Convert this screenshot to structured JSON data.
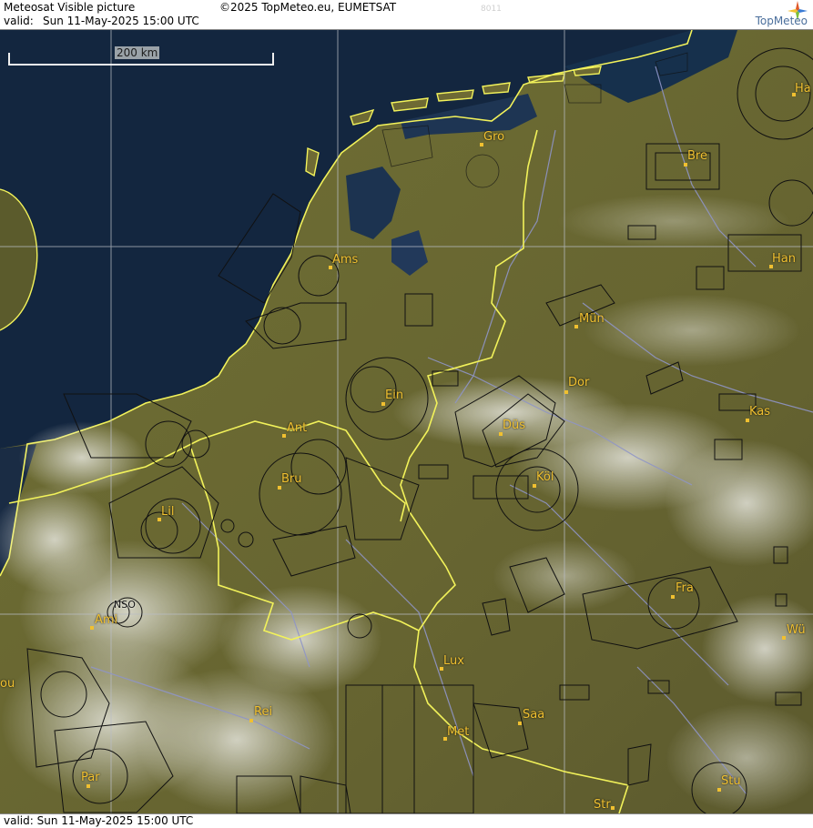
{
  "header": {
    "title": "Meteosat Visible picture",
    "copyright": "©2025 TopMeteo.eu, EUMETSAT",
    "code": "8011",
    "valid_label": "valid:",
    "valid_value": "Sun  11-May-2025  15:00 UTC",
    "logo_name": "TopMeteo"
  },
  "footer": {
    "valid_text": "valid:  Sun  11-May-2025  15:00 UTC"
  },
  "scale": {
    "label": "200 km"
  },
  "colors": {
    "sea": "#13263f",
    "land": "#6f6a33",
    "border": "#f2f25a",
    "airspace": "#111111",
    "river": "#8f95c7",
    "grid": "#b8bcc4",
    "label": "#f0c030"
  },
  "cities": [
    {
      "name": "Gro"
    },
    {
      "name": "Bre"
    },
    {
      "name": "Ha"
    },
    {
      "name": "Ams"
    },
    {
      "name": "Han"
    },
    {
      "name": "Mün"
    },
    {
      "name": "Ein"
    },
    {
      "name": "Dor"
    },
    {
      "name": "Kas"
    },
    {
      "name": "Ant"
    },
    {
      "name": "Düs"
    },
    {
      "name": "Bru"
    },
    {
      "name": "Köl"
    },
    {
      "name": "Lil"
    },
    {
      "name": "Fra"
    },
    {
      "name": "Ami"
    },
    {
      "name": "NSO"
    },
    {
      "name": "Wü"
    },
    {
      "name": "Lux"
    },
    {
      "name": "Rei"
    },
    {
      "name": "Saa"
    },
    {
      "name": "Met"
    },
    {
      "name": "Par"
    },
    {
      "name": "Stu"
    },
    {
      "name": "Str"
    },
    {
      "name": "ou"
    }
  ]
}
